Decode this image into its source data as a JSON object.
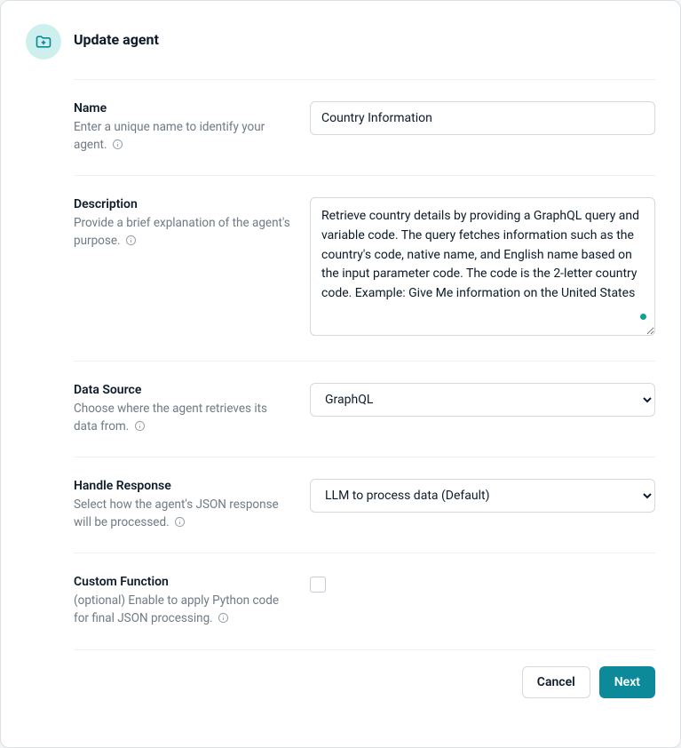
{
  "header": {
    "title": "Update agent"
  },
  "fields": {
    "name": {
      "label": "Name",
      "help": "Enter a unique name to identify your agent.",
      "value": "Country Information"
    },
    "description": {
      "label": "Description",
      "help": "Provide a brief explanation of the agent's purpose.",
      "value": "Retrieve country details by providing a GraphQL query and variable code. The query fetches information such as the country's code, native name, and English name based on the input parameter code. The code is the 2-letter country code. Example: Give Me information on the United States"
    },
    "data_source": {
      "label": "Data Source",
      "help": "Choose where the agent retrieves its data from.",
      "selected": "GraphQL",
      "options": [
        "GraphQL"
      ]
    },
    "handle_response": {
      "label": "Handle Response",
      "help": "Select how the agent's JSON response will be processed.",
      "selected": "LLM to process data (Default)",
      "options": [
        "LLM to process data (Default)"
      ]
    },
    "custom_function": {
      "label": "Custom Function",
      "help": "(optional) Enable to apply Python code for final JSON processing.",
      "checked": false
    }
  },
  "footer": {
    "cancel_label": "Cancel",
    "next_label": "Next"
  }
}
